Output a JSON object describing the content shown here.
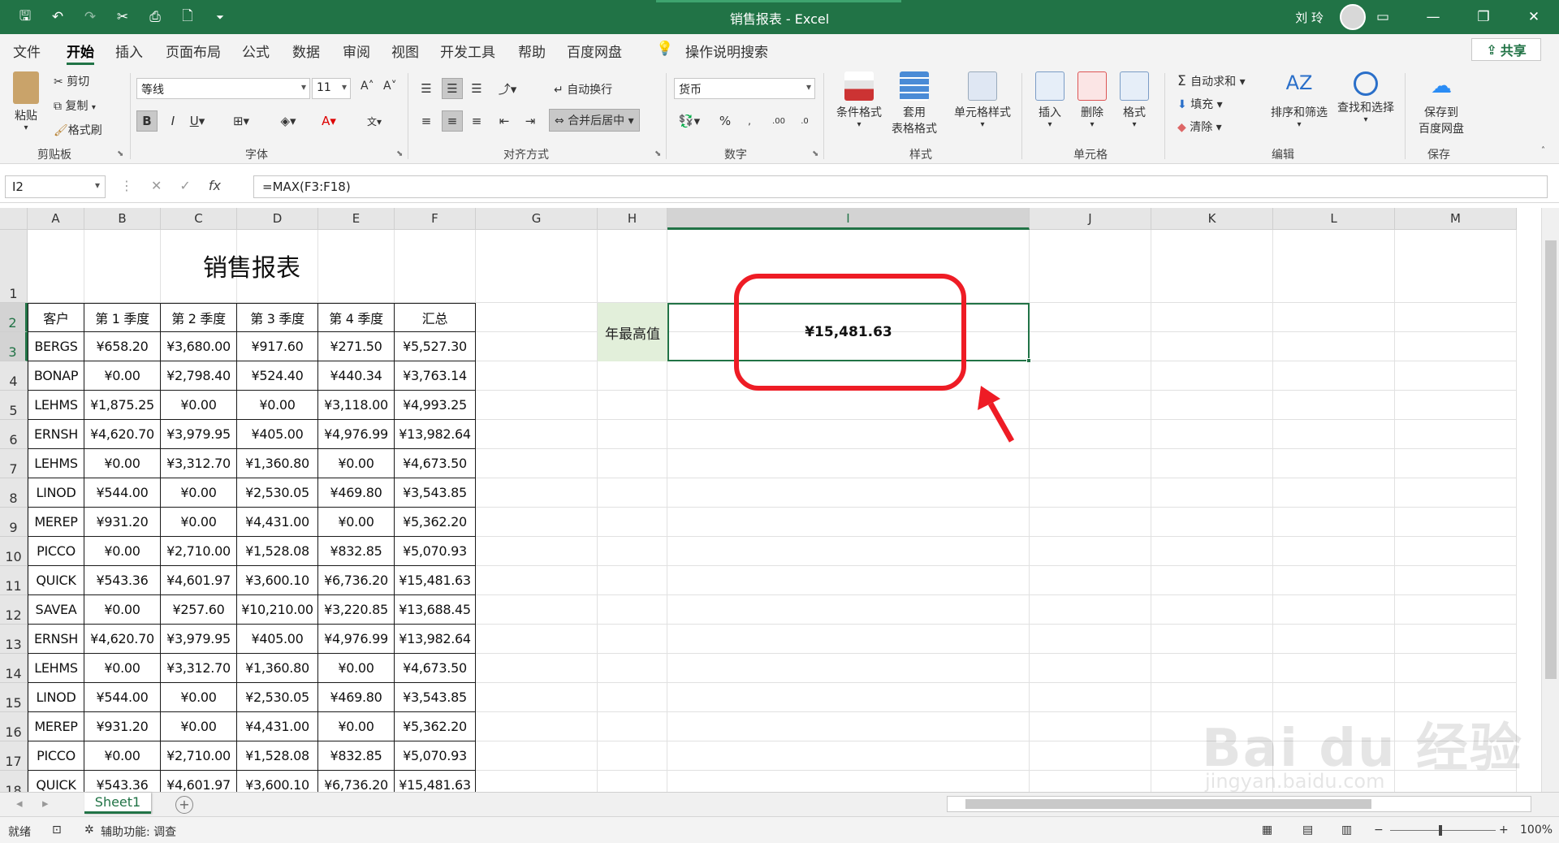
{
  "window": {
    "title": "销售报表 - Excel",
    "user": "刘 玲"
  },
  "menu": {
    "tabs": [
      "文件",
      "开始",
      "插入",
      "页面布局",
      "公式",
      "数据",
      "审阅",
      "视图",
      "开发工具",
      "帮助",
      "百度网盘"
    ],
    "active_tab": "开始",
    "search": "操作说明搜索",
    "share": "共享"
  },
  "ribbon": {
    "clipboard": {
      "paste": "粘贴",
      "cut": "剪切",
      "copy": "复制",
      "format_painter": "格式刷",
      "label": "剪贴板"
    },
    "font": {
      "name": "等线",
      "size": "11",
      "label": "字体"
    },
    "alignment": {
      "wrap_text": "自动换行",
      "merge_center": "合并后居中",
      "label": "对齐方式"
    },
    "number": {
      "format": "货币",
      "label": "数字"
    },
    "styles": {
      "conditional": "条件格式",
      "table_format": "套用\n表格格式",
      "cell_styles": "单元格样式",
      "label": "样式"
    },
    "cells": {
      "insert": "插入",
      "delete": "删除",
      "format": "格式",
      "label": "单元格"
    },
    "editing": {
      "autosum": "自动求和",
      "fill": "填充",
      "clear": "清除",
      "sort_filter": "排序和筛选",
      "find_select": "查找和选择",
      "label": "编辑"
    },
    "save": {
      "save_to_baidu": "保存到\n百度网盘",
      "label": "保存"
    }
  },
  "formula_bar": {
    "name_box": "I2",
    "formula": "=MAX(F3:F18)"
  },
  "sheet": {
    "columns": [
      "A",
      "B",
      "C",
      "D",
      "E",
      "F",
      "G",
      "H",
      "I",
      "J",
      "K",
      "L",
      "M"
    ],
    "selected_column": "I",
    "rows": [
      "1",
      "2",
      "3",
      "4",
      "5",
      "6",
      "7",
      "8",
      "9",
      "10",
      "11",
      "12",
      "13",
      "14",
      "15",
      "16",
      "17",
      "18"
    ],
    "selected_rows": [
      "2",
      "3"
    ],
    "table_title": "销售报表",
    "headers": [
      "客户",
      "第 1 季度",
      "第 2 季度",
      "第 3 季度",
      "第 4 季度",
      "汇总"
    ],
    "data": [
      [
        "BERGS",
        "¥658.20",
        "¥3,680.00",
        "¥917.60",
        "¥271.50",
        "¥5,527.30"
      ],
      [
        "BONAP",
        "¥0.00",
        "¥2,798.40",
        "¥524.40",
        "¥440.34",
        "¥3,763.14"
      ],
      [
        "LEHMS",
        "¥1,875.25",
        "¥0.00",
        "¥0.00",
        "¥3,118.00",
        "¥4,993.25"
      ],
      [
        "ERNSH",
        "¥4,620.70",
        "¥3,979.95",
        "¥405.00",
        "¥4,976.99",
        "¥13,982.64"
      ],
      [
        "LEHMS",
        "¥0.00",
        "¥3,312.70",
        "¥1,360.80",
        "¥0.00",
        "¥4,673.50"
      ],
      [
        "LINOD",
        "¥544.00",
        "¥0.00",
        "¥2,530.05",
        "¥469.80",
        "¥3,543.85"
      ],
      [
        "MEREP",
        "¥931.20",
        "¥0.00",
        "¥4,431.00",
        "¥0.00",
        "¥5,362.20"
      ],
      [
        "PICCO",
        "¥0.00",
        "¥2,710.00",
        "¥1,528.08",
        "¥832.85",
        "¥5,070.93"
      ],
      [
        "QUICK",
        "¥543.36",
        "¥4,601.97",
        "¥3,600.10",
        "¥6,736.20",
        "¥15,481.63"
      ],
      [
        "SAVEA",
        "¥0.00",
        "¥257.60",
        "¥10,210.00",
        "¥3,220.85",
        "¥13,688.45"
      ],
      [
        "ERNSH",
        "¥4,620.70",
        "¥3,979.95",
        "¥405.00",
        "¥4,976.99",
        "¥13,982.64"
      ],
      [
        "LEHMS",
        "¥0.00",
        "¥3,312.70",
        "¥1,360.80",
        "¥0.00",
        "¥4,673.50"
      ],
      [
        "LINOD",
        "¥544.00",
        "¥0.00",
        "¥2,530.05",
        "¥469.80",
        "¥3,543.85"
      ],
      [
        "MEREP",
        "¥931.20",
        "¥0.00",
        "¥4,431.00",
        "¥0.00",
        "¥5,362.20"
      ],
      [
        "PICCO",
        "¥0.00",
        "¥2,710.00",
        "¥1,528.08",
        "¥832.85",
        "¥5,070.93"
      ],
      [
        "QUICK",
        "¥543.36",
        "¥4,601.97",
        "¥3,600.10",
        "¥6,736.20",
        "¥15,481.63"
      ]
    ],
    "max_label": "年最高值",
    "max_value": "¥15,481.63"
  },
  "sheet_tabs": {
    "active": "Sheet1"
  },
  "status": {
    "ready": "就绪",
    "accessibility": "辅助功能: 调查",
    "zoom": "100%"
  },
  "watermark": {
    "brand": "Bai du 经验",
    "url": "jingyan.baidu.com"
  },
  "colors": {
    "excel_green": "#217346",
    "highlight_red": "#ee1c25",
    "label_fill": "#e2efda"
  }
}
